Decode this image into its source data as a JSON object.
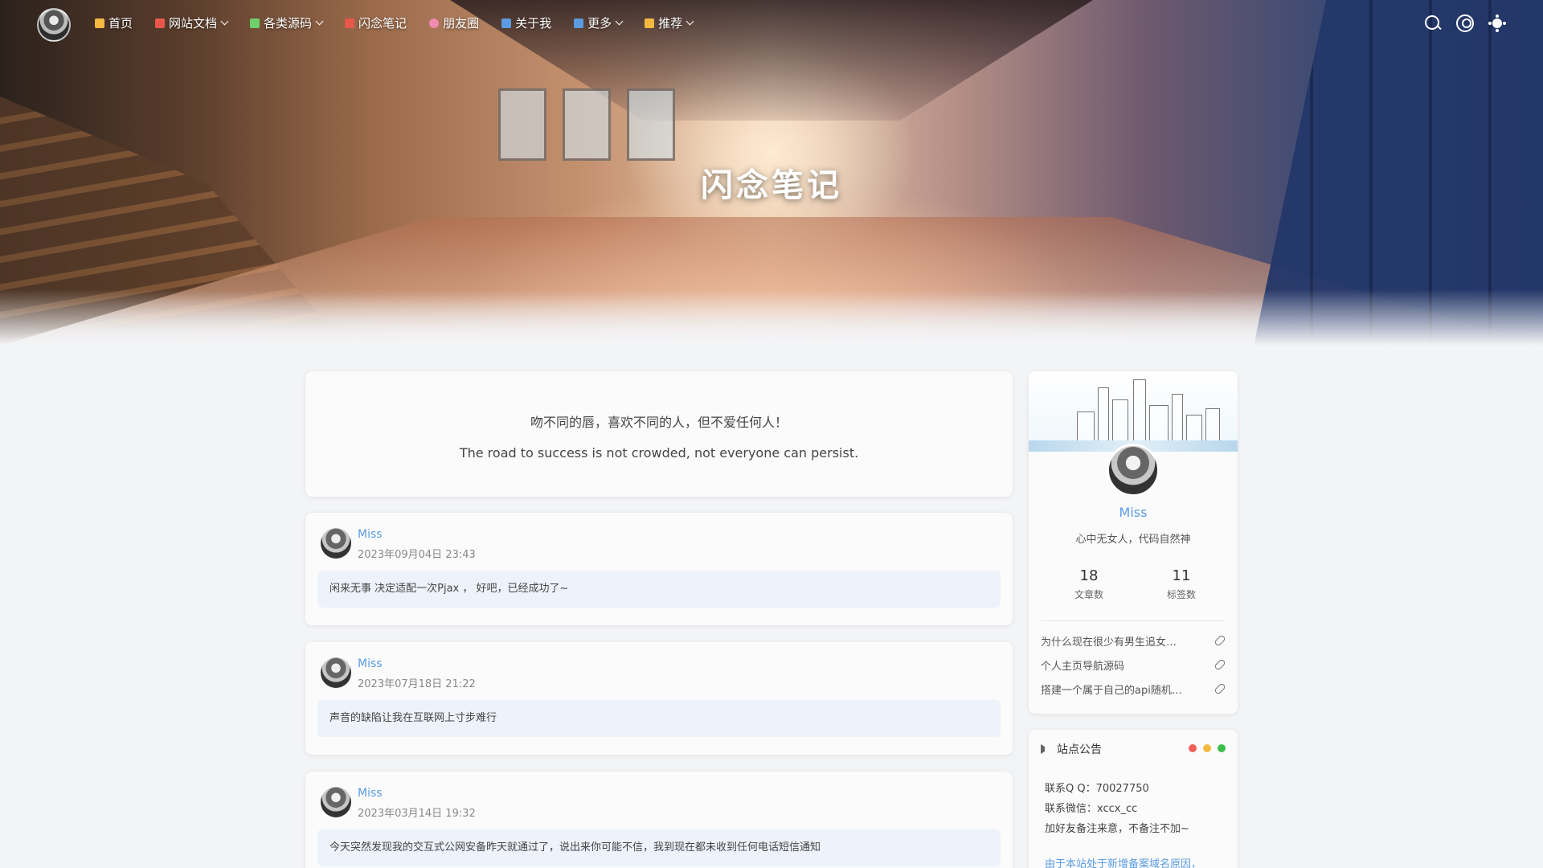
{
  "hero": {
    "title": "闪念笔记"
  },
  "nav": {
    "items": [
      {
        "label": "首页",
        "icon": "home-icon",
        "icon_color": "#f5b942",
        "has_dropdown": false
      },
      {
        "label": "网站文档",
        "icon": "document-icon",
        "icon_color": "#e9574b",
        "has_dropdown": true
      },
      {
        "label": "各类源码",
        "icon": "source-code-icon",
        "icon_color": "#6fcf6a",
        "has_dropdown": true
      },
      {
        "label": "闪念笔记",
        "icon": "notes-icon",
        "icon_color": "#e9574b",
        "has_dropdown": false
      },
      {
        "label": "朋友圈",
        "icon": "friends-icon",
        "icon_color": "#f08ab0",
        "has_dropdown": false
      },
      {
        "label": "关于我",
        "icon": "about-icon",
        "icon_color": "#5a9be2",
        "has_dropdown": false
      },
      {
        "label": "更多",
        "icon": "grid-icon",
        "icon_color": "#5a9be2",
        "has_dropdown": true
      },
      {
        "label": "推荐",
        "icon": "bookmark-icon",
        "icon_color": "#f5b942",
        "has_dropdown": true
      }
    ]
  },
  "motto": {
    "cn": "吻不同的唇，喜欢不同的人，但不爱任何人！",
    "en": "The road to success is not crowded, not everyone can persist."
  },
  "posts": [
    {
      "author": "Miss",
      "date": "2023年09月04日 23:43",
      "content": "闲来无事 决定适配一次Pjax ， 好吧，已经成功了~"
    },
    {
      "author": "Miss",
      "date": "2023年07月18日 21:22",
      "content": "声音的缺陷让我在互联网上寸步难行"
    },
    {
      "author": "Miss",
      "date": "2023年03月14日 19:32",
      "content": "今天突然发现我的交互式公网安备昨天就通过了，说出来你可能不信，我到现在都未收到任何电话短信通知"
    }
  ],
  "profile": {
    "name": "Miss",
    "bio": "心中无女人，代码自然神",
    "stats": [
      {
        "value": "18",
        "label": "文章数"
      },
      {
        "value": "11",
        "label": "标签数"
      }
    ],
    "links": [
      "为什么现在很少有男生追女…",
      "个人主页导航源码",
      "搭建一个属于自己的api随机…"
    ]
  },
  "notice": {
    "title": "站点公告",
    "dot_colors": [
      "#f25f57",
      "#f5b942",
      "#3bbf4a"
    ],
    "lines": [
      "联系Q Q：70027750",
      "联系微信：xccx_cc",
      "加好友备注来意，不备注不加~"
    ],
    "link": "由于本站处于新增备案域名原因，"
  }
}
